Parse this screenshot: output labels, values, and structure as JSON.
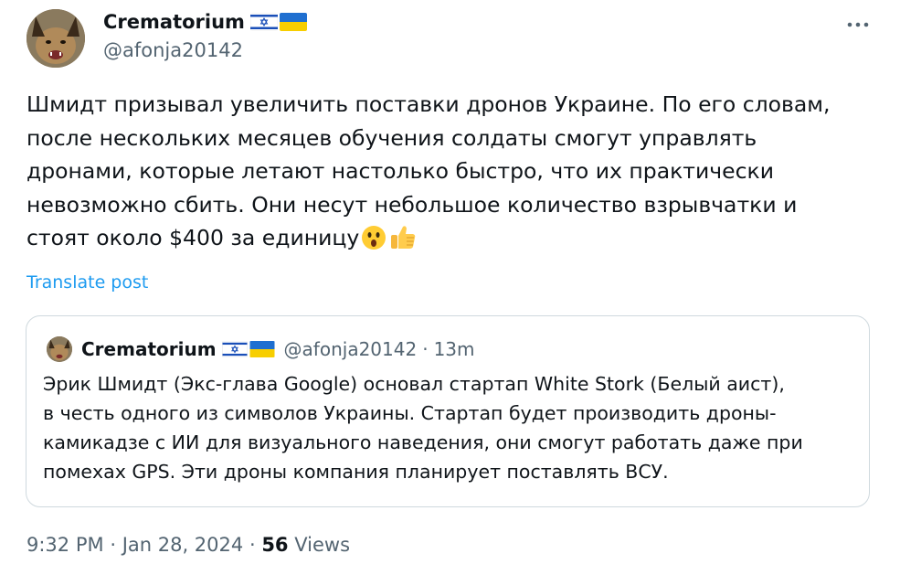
{
  "author": {
    "name": "Crematorium",
    "handle": "@afonja20142"
  },
  "post": {
    "lines": [
      "Шмидт призывал увеличить поставки дронов Украине. По его словам,",
      "после нескольких месяцев обучения солдаты смогут управлять",
      "дронами, которые летают настолько быстро, что их практически",
      "невозможно сбить. Они несут небольшое количество взрывчатки и",
      "стоят около $400  за единицу"
    ],
    "emojis": [
      "astonished-face",
      "thumbs-up"
    ]
  },
  "translate_label": "Translate post",
  "quote": {
    "name": "Crematorium",
    "handle": "@afonja20142",
    "separator": "·",
    "time": "13m",
    "lines": [
      "Эрик Шмидт (Экс-глава Google) основал стартап White Stork (Белый аист),",
      "в честь одного из символов Украины. Стартап будет производить дроны-",
      "камикадзе с ИИ для визуального наведения, они смогут работать даже при",
      "помехах GPS. Эти дроны компания планирует поставлять ВСУ."
    ]
  },
  "meta": {
    "time": "9:32 PM",
    "sep1": "·",
    "date": "Jan 28, 2024",
    "sep2": "·",
    "views_count": "56",
    "views_label": "Views"
  },
  "colors": {
    "text": "#0f1419",
    "secondary": "#536471",
    "link": "#1d9bf0",
    "border": "#cfd9de"
  },
  "icons": {
    "more": "more-dots-icon",
    "flag_israel": "israel-flag-icon",
    "flag_ukraine": "ukraine-flag-icon"
  }
}
